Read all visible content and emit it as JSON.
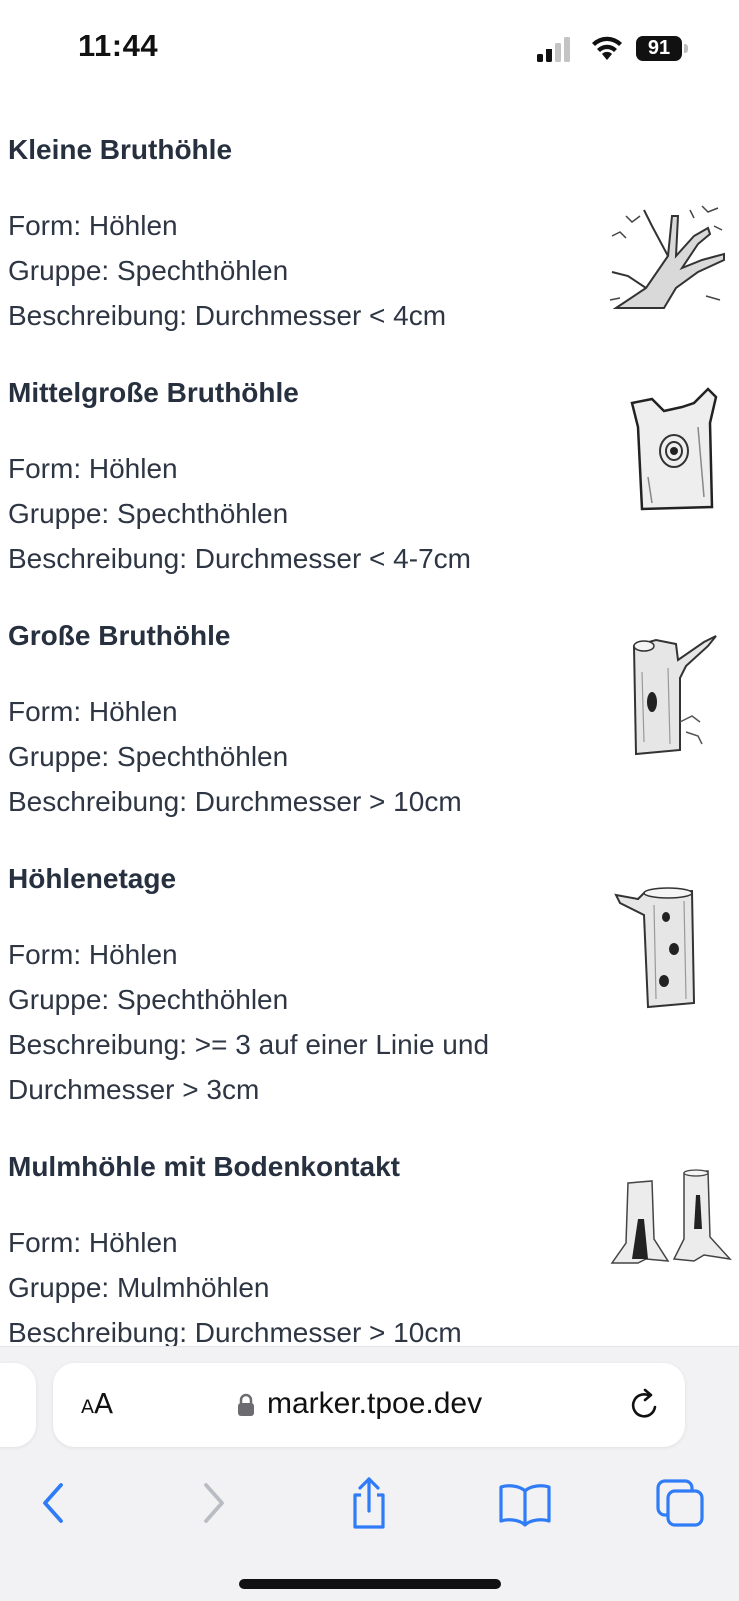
{
  "status_bar": {
    "time": "11:44",
    "battery": "91"
  },
  "entries": [
    {
      "title": "Kleine Bruthöhle",
      "lines": [
        "Form: Höhlen",
        "Gruppe: Spechthöhlen",
        "Beschreibung: Durchmesser < 4cm"
      ],
      "image_icon": "tree-branches-illustration"
    },
    {
      "title": "Mittelgroße Bruthöhle",
      "lines": [
        "Form: Höhlen",
        "Gruppe: Spechthöhlen",
        "Beschreibung: Durchmesser < 4-7cm"
      ],
      "image_icon": "trunk-with-hole-illustration"
    },
    {
      "title": "Große Bruthöhle",
      "lines": [
        "Form: Höhlen",
        "Gruppe: Spechthöhlen",
        "Beschreibung: Durchmesser > 10cm"
      ],
      "image_icon": "trunk-with-large-hole-illustration"
    },
    {
      "title": "Höhlenetage",
      "lines": [
        "Form: Höhlen",
        "Gruppe: Spechthöhlen",
        "Beschreibung: >= 3 auf einer Linie und",
        "Durchmesser > 3cm"
      ],
      "image_icon": "trunk-with-stacked-holes-illustration"
    },
    {
      "title": "Mulmhöhle mit Bodenkontakt",
      "lines": [
        "Form: Höhlen",
        "Gruppe: Mulmhöhlen",
        "Beschreibung: Durchmesser > 10cm"
      ],
      "image_icon": "trunk-bases-illustration"
    }
  ],
  "browser": {
    "text_size_small": "A",
    "text_size_large": "A",
    "url": "marker.tpoe.dev",
    "icons": {
      "back": "chevron-left-icon",
      "forward": "chevron-right-icon",
      "share": "share-icon",
      "bookmarks": "book-icon",
      "tabs": "tabs-icon",
      "reload": "reload-icon",
      "lock": "lock-icon"
    },
    "accent_color": "#2f7cf6",
    "disabled_color": "#b9bcc2"
  }
}
